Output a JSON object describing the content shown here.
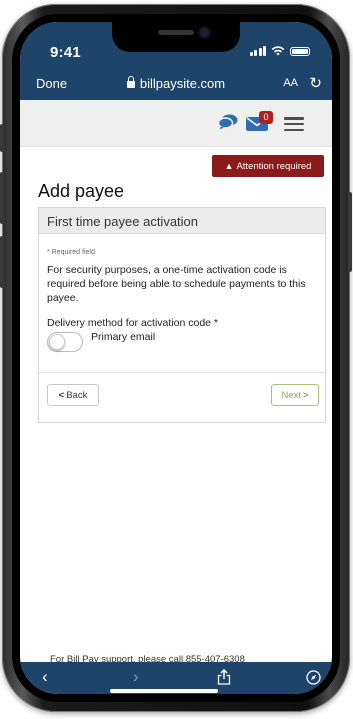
{
  "status": {
    "time": "9:41"
  },
  "browser": {
    "done_label": "Done",
    "url": "billpaysite.com",
    "text_size_label": "AA",
    "reload_glyph": "↻"
  },
  "header": {
    "mail_badge": "0"
  },
  "alert": {
    "label": "Attention required"
  },
  "page": {
    "title": "Add payee"
  },
  "card": {
    "heading": "First time payee activation",
    "required_note": "* Required field",
    "body": "For security purposes, a one-time activation code is required before being able to schedule payments to this payee.",
    "delivery_label": "Delivery method for activation code *",
    "toggle_label": "Primary email",
    "toggle_on": false,
    "back_label": "Back",
    "next_label": "Next"
  },
  "footer": {
    "support_text": "For Bill Pay support, please call 855-407-6308"
  },
  "toolbar": {
    "back": "‹",
    "forward": "›",
    "share": "⇪",
    "compass": "⊘"
  },
  "colors": {
    "nav_blue": "#1e4469",
    "alert_red": "#8b1a1a",
    "next_green": "#a9c27a"
  }
}
